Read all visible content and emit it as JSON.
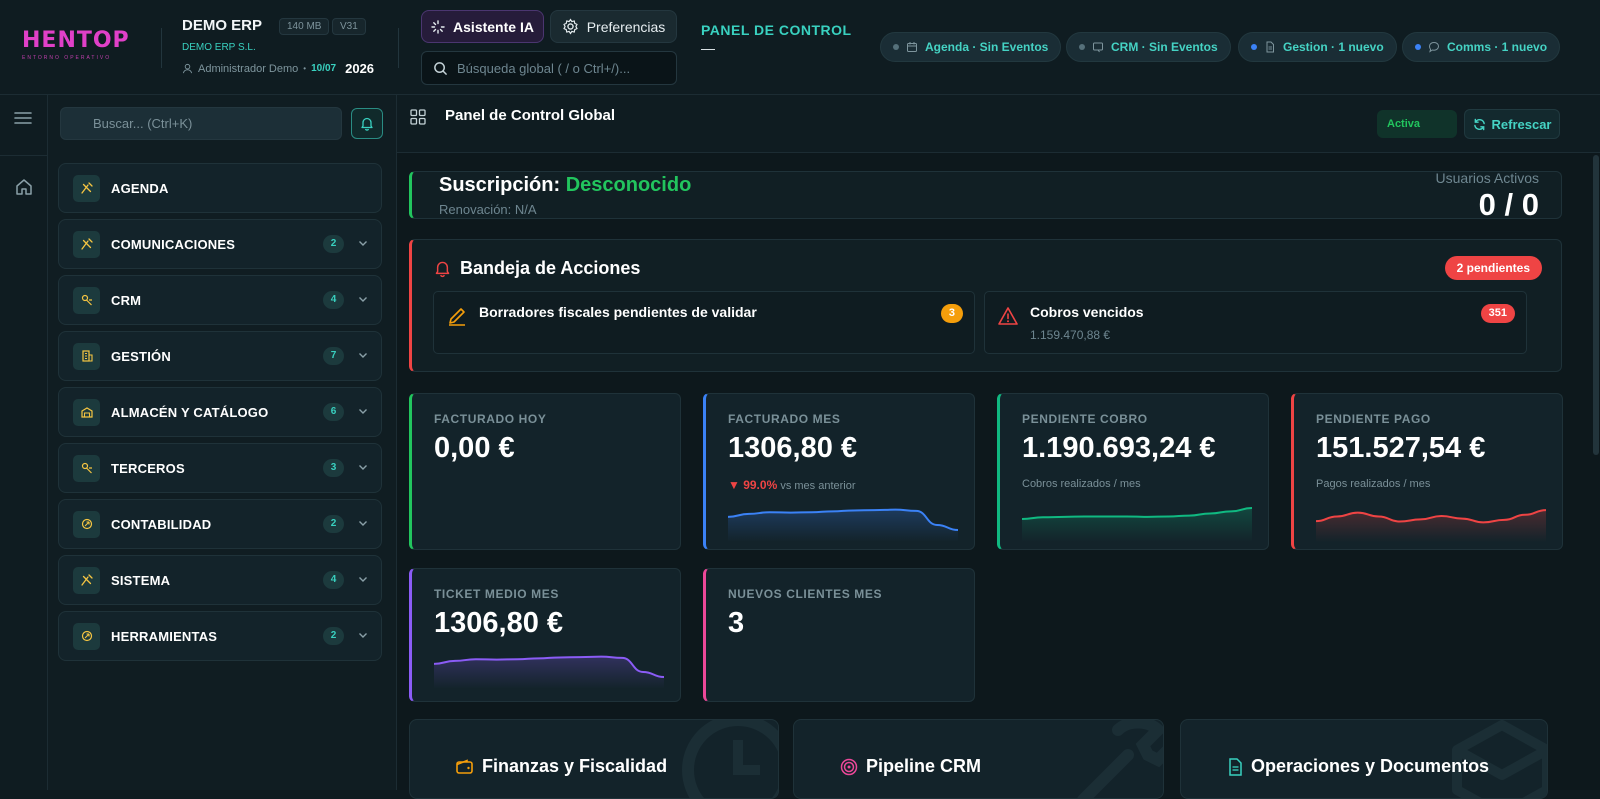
{
  "topbar": {
    "logo_text": "HENTOP",
    "logo_sub": "ENTORNO OPERATIVO",
    "app_title": "DEMO ERP",
    "storage_badge": "140 MB",
    "version_badge": "V31",
    "company": "DEMO ERP S.L.",
    "user": "Administrador Demo",
    "date": "10/07",
    "year": "2026",
    "ai_button": "Asistente IA",
    "prefs_button": "Preferencias",
    "search_placeholder": "Búsqueda global ( / o Ctrl+/)...",
    "panel_title": "PANEL DE CONTROL",
    "panel_sub": "—",
    "chips": [
      {
        "label": "Agenda · Sin Eventos",
        "icon": "calendar-icon",
        "dot": "gray"
      },
      {
        "label": "CRM · Sin Eventos",
        "icon": "crm-icon",
        "dot": "gray"
      },
      {
        "label": "Gestion · 1 nuevo",
        "icon": "document-icon",
        "dot": "blue"
      },
      {
        "label": "Comms · 1 nuevo",
        "icon": "chat-icon",
        "dot": "blue"
      }
    ]
  },
  "sidebar": {
    "search_placeholder": "Buscar... (Ctrl+K)",
    "items": [
      {
        "label": "AGENDA",
        "badge": ""
      },
      {
        "label": "COMUNICACIONES",
        "badge": "2"
      },
      {
        "label": "CRM",
        "badge": "4"
      },
      {
        "label": "GESTIÓN",
        "badge": "7"
      },
      {
        "label": "ALMACÉN Y CATÁLOGO",
        "badge": "6"
      },
      {
        "label": "TERCEROS",
        "badge": "3"
      },
      {
        "label": "CONTABILIDAD",
        "badge": "2"
      },
      {
        "label": "SISTEMA",
        "badge": "4"
      },
      {
        "label": "HERRAMIENTAS",
        "badge": "2"
      }
    ]
  },
  "main": {
    "title": "Panel de Control Global",
    "status": "Activa",
    "refresh": "Refrescar",
    "subscription": {
      "label": "Suscripción:",
      "value": "Desconocido",
      "renewal": "Renovación: N/A",
      "users_label": "Usuarios Activos",
      "users_value": "0 / 0"
    },
    "inbox": {
      "title": "Bandeja de Acciones",
      "badge": "2 pendientes",
      "items": [
        {
          "title": "Borradores fiscales pendientes de validar",
          "sub": "",
          "count": "3"
        },
        {
          "title": "Cobros vencidos",
          "sub": "1.159.470,88 €",
          "count": "351"
        }
      ]
    },
    "kpis": [
      {
        "label": "FACTURADO HOY",
        "value": "0,00 €",
        "sub": "",
        "trend": "",
        "color": "#22c55e",
        "spark": []
      },
      {
        "label": "FACTURADO MES",
        "value": "1306,80 €",
        "trend": "▼ 99.0%",
        "sub": "vs mes anterior",
        "color": "#3b82f6",
        "spark": [
          4.5,
          5.2,
          5.6,
          5.5,
          5.6,
          5.8,
          6.0,
          6.1,
          6.2,
          5.9,
          2.6,
          1.4
        ]
      },
      {
        "label": "PENDIENTE COBRO",
        "value": "1.190.693,24 €",
        "trend": "",
        "sub": "Cobros realizados / mes",
        "color": "#10b981",
        "spark": [
          4.0,
          4.4,
          4.5,
          4.6,
          4.6,
          4.6,
          4.5,
          4.6,
          4.8,
          5.3,
          5.8,
          6.6
        ]
      },
      {
        "label": "PENDIENTE PAGO",
        "value": "151.527,54 €",
        "trend": "",
        "sub": "Pagos realizados / mes",
        "color": "#ef4444",
        "spark": [
          3.5,
          4.6,
          5.5,
          4.6,
          3.4,
          3.9,
          4.7,
          4.1,
          3.2,
          3.8,
          5.0,
          6.1
        ]
      },
      {
        "label": "TICKET MEDIO MES",
        "value": "1306,80 €",
        "trend": "",
        "sub": "",
        "color": "#8b5cf6",
        "spark": [
          4.5,
          5.2,
          5.6,
          5.5,
          5.6,
          5.8,
          6.0,
          6.1,
          6.2,
          5.9,
          2.6,
          1.4
        ]
      },
      {
        "label": "NUEVOS CLIENTES MES",
        "value": "3",
        "trend": "",
        "sub": "",
        "color": "#ec4899",
        "spark": []
      }
    ],
    "sections": [
      {
        "title": "Finanzas y Fiscalidad",
        "color": "#f59e0b"
      },
      {
        "title": "Pipeline CRM",
        "color": "#ec4899"
      },
      {
        "title": "Operaciones y Documentos",
        "color": "#39d1c0"
      }
    ]
  }
}
